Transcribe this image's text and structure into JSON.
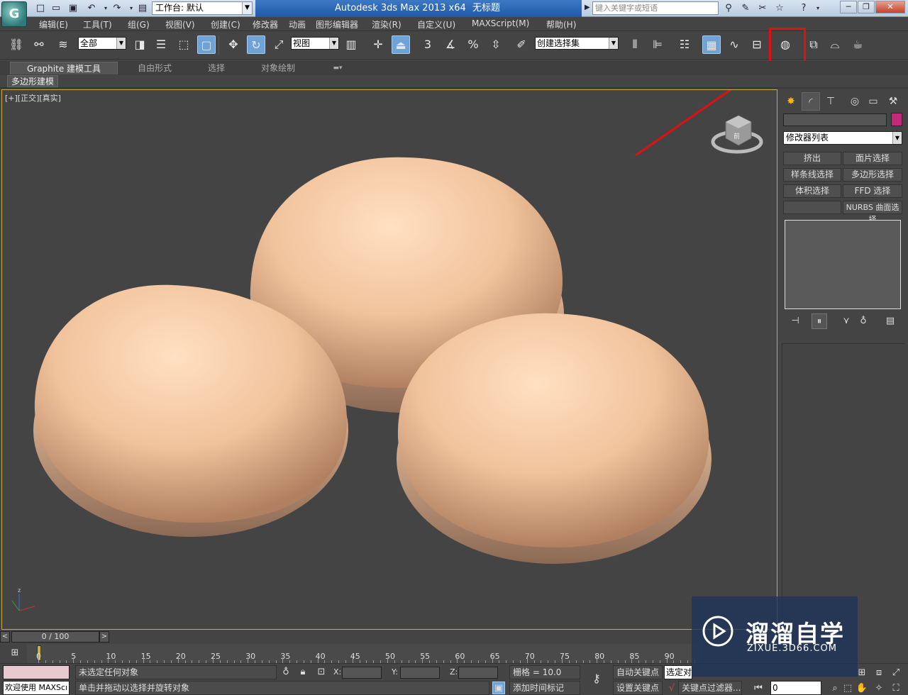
{
  "titlebar": {
    "workspace": "工作台: 默认",
    "app_title": "Autodesk 3ds Max  2013 x64",
    "doc_title": "无标题",
    "search_placeholder": "键入关键字或短语"
  },
  "menubar": {
    "items": [
      "编辑(E)",
      "工具(T)",
      "组(G)",
      "视图(V)",
      "创建(C)",
      "修改器",
      "动画",
      "图形编辑器",
      "渲染(R)",
      "自定义(U)",
      "MAXScript(M)",
      "帮助(H)"
    ]
  },
  "toolbar": {
    "selection_filter": "全部",
    "ref_coord": "视图",
    "named_selection": "创建选择集",
    "snap_3": "3",
    "percent": "%",
    "highlighted_button": "render-setup-button",
    "highlight_color": "#e01010"
  },
  "ribbon": {
    "tabs": [
      "Graphite 建模工具",
      "自由形式",
      "选择",
      "对象绘制"
    ],
    "sub_panel": "多边形建模"
  },
  "viewport": {
    "label": "[+][正交][真实]",
    "object_color": "#f0c8a0",
    "viewcube_face": "前"
  },
  "command_panel": {
    "modifier_list": "修改器列表",
    "swatch_color": "#c4287b",
    "buttons": [
      "挤出",
      "面片选择",
      "样条线选择",
      "多边形选择",
      "体积选择",
      "FFD 选择",
      "",
      "NURBS 曲面选择"
    ]
  },
  "timeline": {
    "frame_display": "0 / 100",
    "ticks": [
      "0",
      "5",
      "10",
      "15",
      "20",
      "25",
      "30",
      "35",
      "40",
      "45",
      "50",
      "55",
      "60",
      "65",
      "70",
      "75",
      "80",
      "85",
      "90"
    ]
  },
  "statusbar": {
    "welcome": "欢迎使用 MAXScı",
    "status_top": "未选定任何对象",
    "status_bottom": "单击并拖动以选择并旋转对象",
    "x_label": "X:",
    "y_label": "Y:",
    "z_label": "Z:",
    "grid": "栅格 = 10.0",
    "auto_key": "自动关键点",
    "set_key": "设置关键点",
    "selected": "选定对",
    "key_filter": "关键点过滤器...",
    "add_time_tag": "添加时间标记",
    "frame_value": "0"
  },
  "watermark": {
    "title": "溜溜自学",
    "subtitle": "ZIXUE.3D66.COM"
  }
}
